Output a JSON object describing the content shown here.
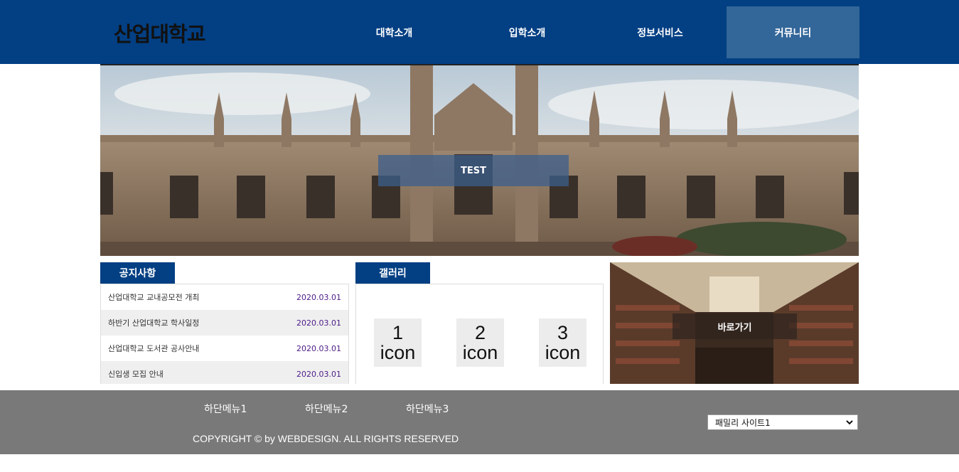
{
  "header": {
    "logo": "산업대학교",
    "nav": [
      "대학소개",
      "입학소개",
      "정보서비스",
      "커뮤니티"
    ],
    "active_nav": "커뮤니티"
  },
  "hero": {
    "caption": "TEST"
  },
  "notice": {
    "title": "공지사항",
    "items": [
      {
        "title": "산업대학교 교내공모전 개최",
        "date": "2020.03.01"
      },
      {
        "title": "하반기 산업대학교 학사일정",
        "date": "2020.03.01"
      },
      {
        "title": "산업대학교 도서관 공사안내",
        "date": "2020.03.01"
      },
      {
        "title": "신입생 모집 안내",
        "date": "2020.03.01"
      }
    ]
  },
  "gallery": {
    "title": "갤러리",
    "icons": [
      {
        "number": "1",
        "label": "icon"
      },
      {
        "number": "2",
        "label": "icon"
      },
      {
        "number": "3",
        "label": "icon"
      }
    ]
  },
  "shortcut": {
    "label": "바로가기"
  },
  "footer": {
    "menus": [
      "하단메뉴1",
      "하단메뉴2",
      "하단메뉴3"
    ],
    "copyright": "COPYRIGHT © by WEBDESIGN. ALL RIGHTS RESERVED",
    "family_site": {
      "selected": "패밀리 사이트1"
    }
  },
  "colors": {
    "header_bg": "#023f83",
    "active_nav_bg": "#336699",
    "footer_bg": "#797979"
  }
}
